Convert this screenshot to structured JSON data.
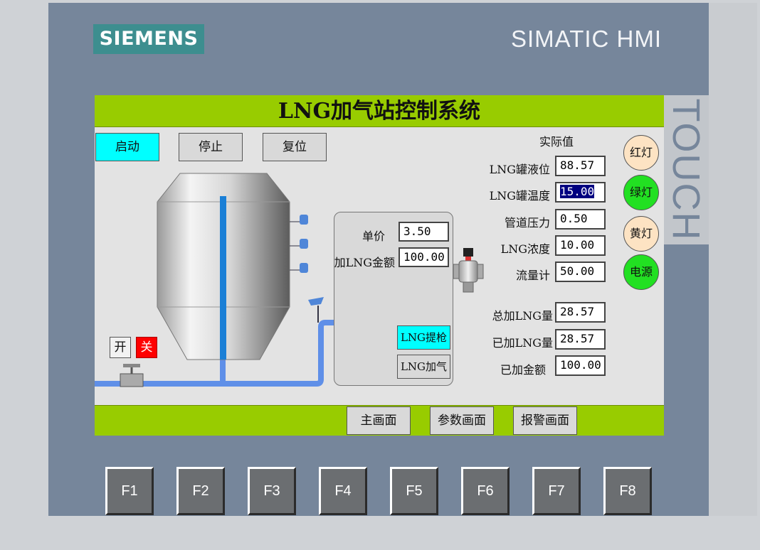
{
  "device": {
    "brand": "SIEMENS",
    "model": "SIMATIC HMI",
    "touch_label": "TOUCH",
    "function_keys": [
      "F1",
      "F2",
      "F3",
      "F4",
      "F5",
      "F6",
      "F7",
      "F8"
    ]
  },
  "screen": {
    "title": "LNG加气站控制系统",
    "controls": {
      "start": "启动",
      "stop": "停止",
      "reset": "复位"
    },
    "actual_values_header": "实际值",
    "readings": [
      {
        "label": "LNG罐液位",
        "value": "88.57"
      },
      {
        "label": "LNG罐温度",
        "value": "15.00"
      },
      {
        "label": "管道压力",
        "value": "0.50"
      },
      {
        "label": "LNG浓度",
        "value": "10.00"
      },
      {
        "label": "流量计",
        "value": "50.00"
      }
    ],
    "totals": [
      {
        "label": "总加LNG量",
        "value": "28.57"
      },
      {
        "label": "已加LNG量",
        "value": "28.57"
      },
      {
        "label": "已加金额",
        "value": "100.00"
      }
    ],
    "lamps": [
      {
        "label": "红灯",
        "color": "#fde3c3"
      },
      {
        "label": "绿灯",
        "color": "#22e022"
      },
      {
        "label": "黄灯",
        "color": "#fde3c3"
      },
      {
        "label": "电源",
        "color": "#22e022"
      }
    ],
    "dispenser": {
      "unit_price_label": "单价",
      "unit_price": "3.50",
      "amount_label": "加LNG金额",
      "amount": "100.00",
      "nozzle_button": "LNG提枪",
      "fuel_button": "LNG加气"
    },
    "valve": {
      "open": "开",
      "close": "关"
    },
    "nav": {
      "main": "主画面",
      "params": "参数画面",
      "alarm": "报警画面"
    }
  },
  "colors": {
    "title_bar": "#98cc00",
    "active_button": "#00ffff",
    "pipe": "#5f8fe8",
    "tank_level": "#1a7fd6"
  }
}
